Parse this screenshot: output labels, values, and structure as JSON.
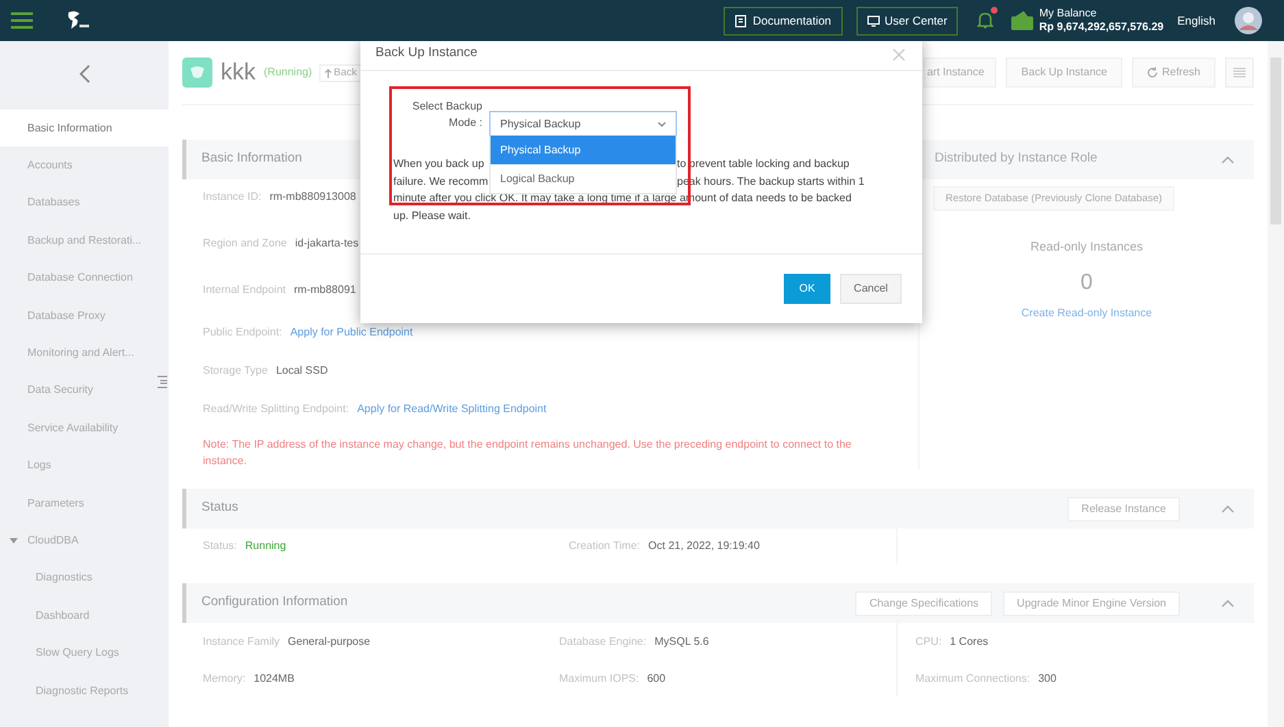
{
  "header": {
    "buttons": [
      "Documentation",
      "User Center"
    ],
    "notification_dot": true,
    "balance_label": "My Balance",
    "balance": "Rp 9,674,292,657,576.29",
    "language": "English"
  },
  "sidebar": {
    "items": [
      {
        "label": "Basic Information",
        "selected": true
      },
      {
        "label": "Accounts",
        "selected": false
      },
      {
        "label": "Databases",
        "selected": false
      },
      {
        "label": "Backup and Restorati...",
        "selected": false
      },
      {
        "label": "Database Connection",
        "selected": false
      },
      {
        "label": "Database Proxy",
        "selected": false
      },
      {
        "label": "Monitoring and Alert...",
        "selected": false
      },
      {
        "label": "Data Security",
        "selected": false
      },
      {
        "label": "Service Availability",
        "selected": false
      },
      {
        "label": "Logs",
        "selected": false
      },
      {
        "label": "Parameters",
        "selected": false
      },
      {
        "label": "CloudDBA",
        "selected": false,
        "expanded": true,
        "children": [
          {
            "label": "Diagnostics",
            "selected": false
          },
          {
            "label": "Dashboard",
            "selected": false
          },
          {
            "label": "Slow Query Logs",
            "selected": false
          },
          {
            "label": "Diagnostic Reports",
            "selected": false
          }
        ]
      }
    ]
  },
  "instance": {
    "name": "kkk",
    "status": "(Running)",
    "cut_button": "Back"
  },
  "toolbar": {
    "buttons": [
      "art Instance",
      "Back Up Instance",
      "Refresh"
    ]
  },
  "basic_info": {
    "title": "Basic Information",
    "fields": [
      {
        "label": "Instance ID:",
        "value": "rm-mb880913008",
        "kind": "text"
      },
      {
        "label": "Region and Zone",
        "value": "id-jakarta-tes",
        "kind": "text"
      },
      {
        "label": "Internal Endpoint",
        "value": "rm-mb88091",
        "kind": "text"
      },
      {
        "label": "Public Endpoint:",
        "value": "Apply for Public Endpoint",
        "kind": "link"
      },
      {
        "label": "Storage Type",
        "value": "Local SSD",
        "kind": "text"
      },
      {
        "label": "Read/Write Splitting Endpoint:",
        "value": "Apply for Read/Write Splitting Endpoint",
        "kind": "link"
      }
    ],
    "note": "Note: The IP address of the instance may change, but the endpoint remains unchanged. Use the preceding endpoint to connect to the instance."
  },
  "role_panel": {
    "title": "Distributed by Instance Role",
    "button": "Restore Database (Previously Clone Database)",
    "readonly_label": "Read-only Instances",
    "readonly_count": "0",
    "create_link": "Create Read-only Instance"
  },
  "status_section": {
    "title": "Status",
    "buttons": [
      "Release Instance"
    ],
    "fields": [
      {
        "label": "Status:",
        "value": "Running",
        "kind": "status"
      },
      {
        "label": "Creation Time:",
        "value": "Oct 21, 2022, 19:19:40",
        "kind": "text"
      }
    ]
  },
  "configuration": {
    "title": "Configuration Information",
    "buttons": [
      "Change Specifications",
      "Upgrade Minor Engine Version"
    ],
    "fields": [
      {
        "label": "Instance Family",
        "value": "General-purpose",
        "kind": "text"
      },
      {
        "label": "Database Engine:",
        "value": "MySQL 5.6",
        "kind": "text"
      },
      {
        "label": "CPU:",
        "value": "1 Cores",
        "kind": "text"
      },
      {
        "label": "Memory:",
        "value": "1024MB",
        "kind": "text"
      },
      {
        "label": "Maximum IOPS:",
        "value": "600",
        "kind": "text"
      },
      {
        "label": "Maximum Connections:",
        "value": "300",
        "kind": "text"
      }
    ]
  },
  "dialog": {
    "title": "Back Up Instance",
    "label": "Select Backup Mode :",
    "select": {
      "value": "Physical Backup",
      "expanded": true
    },
    "options": [
      {
        "label": "Physical Backup",
        "selected": true
      },
      {
        "label": "Logical Backup",
        "selected": false
      }
    ],
    "description_lines": [
      [
        "When you back up",
        "to prevent table locking and backup"
      ],
      [
        "failure. We recomm",
        "peak hours. The backup starts within 1"
      ],
      [
        "minute after you click OK. It may take a long time if a large amount of data needs to be backed"
      ],
      [
        "up. Please wait."
      ]
    ],
    "buttons": [
      "OK",
      "Cancel"
    ]
  }
}
